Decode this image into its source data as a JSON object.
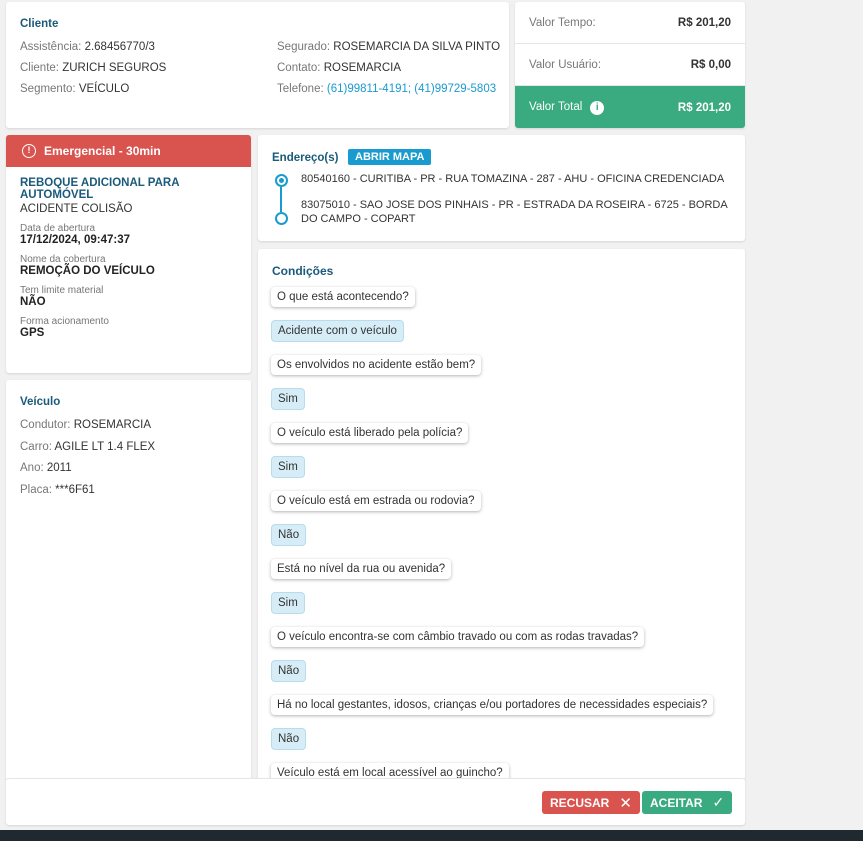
{
  "cliente": {
    "title": "Cliente",
    "assistencia_label": "Assistência:",
    "assistencia": "2.68456770/3",
    "cliente_label": "Cliente:",
    "cliente": "ZURICH SEGUROS",
    "segmento_label": "Segmento:",
    "segmento": "VEÍCULO",
    "segurado_label": "Segurado:",
    "segurado": "ROSEMARCIA DA SILVA PINTO",
    "contato_label": "Contato:",
    "contato": "ROSEMARCIA",
    "telefone_label": "Telefone:",
    "telefone": "(61)99811-4191; (41)99729-5803"
  },
  "valores": {
    "tempo_label": "Valor Tempo:",
    "tempo": "R$ 201,20",
    "usuario_label": "Valor Usuário:",
    "usuario": "R$ 0,00",
    "total_label": "Valor Total",
    "total": "R$ 201,20"
  },
  "servico": {
    "badge": "Emergencial - 30min",
    "nome": "REBOQUE ADICIONAL PARA AUTOMÓVEL",
    "tipo": "ACIDENTE COLISÃO",
    "fields": [
      {
        "label": "Data de abertura",
        "value": "17/12/2024, 09:47:37"
      },
      {
        "label": "Nome da cobertura",
        "value": "REMOÇÃO DO VEÍCULO"
      },
      {
        "label": "Tem limite material",
        "value": "NÃO"
      },
      {
        "label": "Forma acionamento",
        "value": "GPS"
      }
    ]
  },
  "veiculo": {
    "title": "Veículo",
    "condutor_label": "Condutor:",
    "condutor": "ROSEMARCIA",
    "carro_label": "Carro:",
    "carro": "AGILE LT 1.4 FLEX",
    "ano_label": "Ano:",
    "ano": "2011",
    "placa_label": "Placa:",
    "placa": "***6F61"
  },
  "endereco": {
    "title": "Endereço(s)",
    "map_button": "ABRIR MAPA",
    "origem": "80540160 - CURITIBA - PR - RUA TOMAZINA - 287 - AHU - OFICINA CREDENCIADA",
    "destino": "83075010 - SAO JOSE DOS PINHAIS - PR - ESTRADA DA ROSEIRA - 6725 - BORDA DO CAMPO - COPART"
  },
  "condicoes": {
    "title": "Condições",
    "items": [
      {
        "q": "O que está acontecendo?",
        "a": "Acidente com o veículo"
      },
      {
        "q": "Os envolvidos no acidente estão bem?",
        "a": "Sim"
      },
      {
        "q": "O veículo está liberado pela polícia?",
        "a": "Sim"
      },
      {
        "q": "O veículo está em estrada ou rodovia?",
        "a": "Não"
      },
      {
        "q": "Está no nível da rua ou avenida?",
        "a": "Sim"
      },
      {
        "q": "O veículo encontra-se com câmbio travado ou com as rodas travadas?",
        "a": "Não"
      },
      {
        "q": "Há no local gestantes, idosos, crianças e/ou portadores de necessidades especiais?",
        "a": "Não"
      },
      {
        "q": "Veículo está em local acessível ao guincho?",
        "a": null
      }
    ]
  },
  "footer": {
    "recusar": "RECUSAR",
    "aceitar": "ACEITAR"
  },
  "colors": {
    "accent": "#1a5a7a",
    "green": "#3aaa80",
    "red": "#d9534f",
    "link": "#1a9bd0"
  }
}
